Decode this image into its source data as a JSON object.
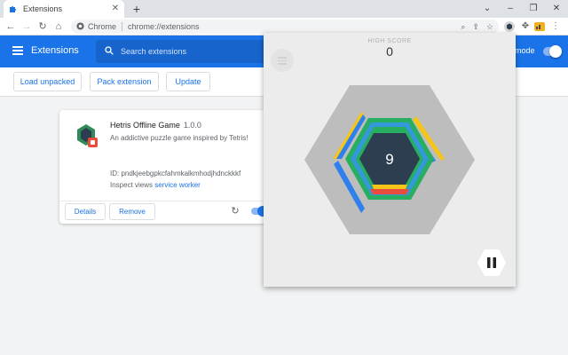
{
  "browser": {
    "tab_title": "Extensions",
    "url_site": "Chrome",
    "url_path": "chrome://extensions"
  },
  "header": {
    "title": "Extensions",
    "search_placeholder": "Search extensions",
    "dev_mode_label": "mode"
  },
  "actions": {
    "load_unpacked": "Load unpacked",
    "pack_extension": "Pack extension",
    "update": "Update"
  },
  "extension_card": {
    "name": "Hetris Offline Game",
    "version": "1.0.0",
    "description": "An addictive puzzle game inspired by Tetris!",
    "id": "ID: pndkjeebgpkcfahmkalkmhodjhdnckkkf",
    "inspect_label": "Inspect views",
    "inspect_link": "service worker",
    "details_label": "Details",
    "remove_label": "Remove",
    "enabled": true
  },
  "game": {
    "high_score_label": "HIGH SCORE",
    "high_score": "0",
    "center_number": "9",
    "colors": {
      "yellow": "#f5c518",
      "blue": "#2f80ed",
      "green": "#27ae60",
      "red": "#e74c3c",
      "dark_hex": "#2c3e50",
      "outer_hex": "#bdbdbd"
    }
  },
  "theme": {
    "accent": "#1a73e8"
  }
}
